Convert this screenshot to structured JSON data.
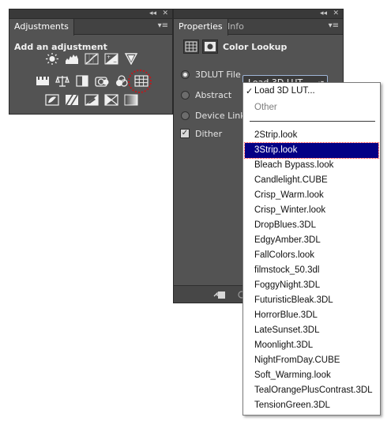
{
  "adjustments_panel": {
    "tab_label": "Adjustments",
    "heading": "Add an adjustment",
    "collapse_glyph": "◂◂",
    "close_glyph": "✕",
    "menu_glyph": "▾≡",
    "icons_row1": [
      "brightness-contrast-icon",
      "levels-icon",
      "curves-icon",
      "exposure-icon",
      "vibrance-icon"
    ],
    "icons_row2": [
      "hue-saturation-icon",
      "color-balance-icon",
      "black-white-icon",
      "photo-filter-icon",
      "channel-mixer-icon",
      "color-lookup-icon"
    ],
    "icons_row3": [
      "invert-icon",
      "posterize-icon",
      "threshold-icon",
      "selective-color-icon",
      "gradient-map-icon"
    ],
    "highlight_color": "#c0181c"
  },
  "properties_panel": {
    "tab_active": "Properties",
    "tab_inactive": "Info",
    "collapse_glyph": "◂◂",
    "close_glyph": "✕",
    "menu_glyph": "▾≡",
    "title": "Color Lookup",
    "options": [
      {
        "label": "3DLUT File",
        "checked": true
      },
      {
        "label": "Abstract",
        "checked": false
      },
      {
        "label": "Device Link",
        "checked": false
      }
    ],
    "dither_label": "Dither",
    "dither_check": "✓",
    "select_value": "Load 3D LUT...",
    "select_arrows": "▴▾"
  },
  "dropdown": {
    "check_mark": "✓",
    "top_items": [
      "Load 3D LUT...",
      "Other"
    ],
    "items": [
      "2Strip.look",
      "3Strip.look",
      "Bleach Bypass.look",
      "Candlelight.CUBE",
      "Crisp_Warm.look",
      "Crisp_Winter.look",
      "DropBlues.3DL",
      "EdgyAmber.3DL",
      "FallColors.look",
      "filmstock_50.3dl",
      "FoggyNight.3DL",
      "FuturisticBleak.3DL",
      "HorrorBlue.3DL",
      "LateSunset.3DL",
      "Moonlight.3DL",
      "NightFromDay.CUBE",
      "Soft_Warming.look",
      "TealOrangePlusContrast.3DL",
      "TensionGreen.3DL"
    ],
    "selected_index": 1,
    "selection_color": "#040085"
  }
}
